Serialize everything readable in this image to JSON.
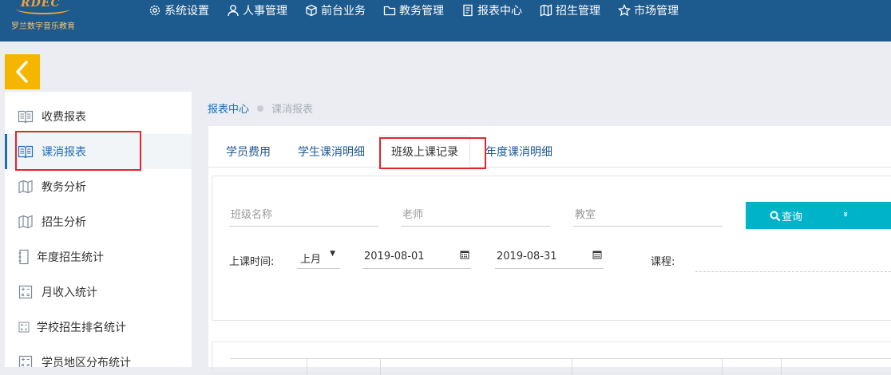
{
  "logo": {
    "mark": "RDEC",
    "subtitle": "罗兰数字音乐教育"
  },
  "nav": [
    {
      "label": "系统设置",
      "icon": "gear-icon"
    },
    {
      "label": "人事管理",
      "icon": "user-icon"
    },
    {
      "label": "前台业务",
      "icon": "cube-icon"
    },
    {
      "label": "教务管理",
      "icon": "folder-icon"
    },
    {
      "label": "报表中心",
      "icon": "document-icon"
    },
    {
      "label": "招生管理",
      "icon": "map-icon"
    },
    {
      "label": "市场管理",
      "icon": "star-icon"
    }
  ],
  "sidebar": {
    "items": [
      {
        "label": "收费报表",
        "icon": "book-icon"
      },
      {
        "label": "课消报表",
        "icon": "book-icon",
        "active": true
      },
      {
        "label": "教务分析",
        "icon": "map-icon"
      },
      {
        "label": "招生分析",
        "icon": "map-icon"
      },
      {
        "label": "年度招生统计",
        "icon": "notebook-icon"
      },
      {
        "label": "月收入统计",
        "icon": "calculator-icon"
      },
      {
        "label": "学校招生排名统计",
        "icon": "calculator-icon"
      },
      {
        "label": "学员地区分布统计",
        "icon": "calculator-icon"
      }
    ]
  },
  "breadcrumb": {
    "root": "报表中心",
    "current": "课消报表"
  },
  "tabs": [
    {
      "label": "学员费用"
    },
    {
      "label": "学生课消明细"
    },
    {
      "label": "班级上课记录",
      "active": true
    },
    {
      "label": "年度课消明细"
    }
  ],
  "filters": {
    "class_name_placeholder": "班级名称",
    "teacher_placeholder": "老师",
    "classroom_placeholder": "教室",
    "query_label": "查询",
    "expand_glyph": "»",
    "time_label": "上课时间:",
    "period_value": "上月",
    "date_start": "2019-08-01",
    "date_end": "2019-08-31",
    "course_label": "课程:"
  },
  "colors": {
    "topbar": "#1d5a8e",
    "accent": "#1e6db5",
    "query_button": "#00b3c8",
    "collapse_button": "#f6b600",
    "highlight_box": "#e0262b"
  }
}
